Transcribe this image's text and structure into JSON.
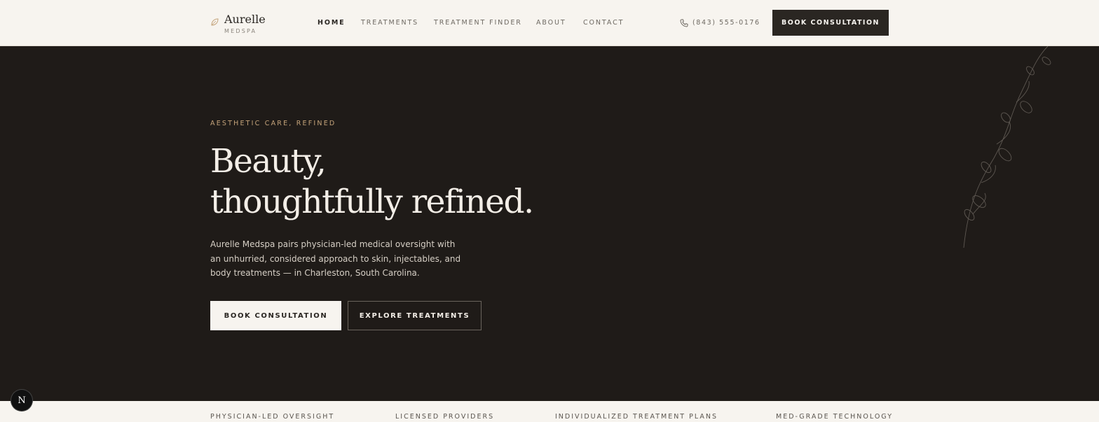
{
  "brand": {
    "name": "Aurelle",
    "sub": "MEDSPA",
    "leaf_color": "#c4a37a"
  },
  "nav": {
    "items": [
      {
        "label": "HOME",
        "active": true
      },
      {
        "label": "TREATMENTS"
      },
      {
        "label": "TREATMENT FINDER"
      },
      {
        "label": "ABOUT"
      },
      {
        "label": "CONTACT"
      }
    ],
    "phone": "(843) 555-0176",
    "cta": "BOOK CONSULTATION"
  },
  "hero": {
    "eyebrow": "AESTHETIC CARE, REFINED",
    "headline": [
      "Beauty,",
      "thoughtfully refined."
    ],
    "body": "Aurelle Medspa pairs physician-led medical oversight with an unhurried, considered approach to skin, injectables, and body treatments — in Charleston, South Carolina.",
    "primary_button": "BOOK CONSULTATION",
    "secondary_button": "EXPLORE TREATMENTS"
  },
  "features": [
    "PHYSICIAN-LED OVERSIGHT",
    "LICENSED PROVIDERS",
    "INDIVIDUALIZED TREATMENT PLANS",
    "MED-GRADE TECHNOLOGY"
  ],
  "badge": {
    "letter": "N"
  },
  "colors": {
    "hero_bg": "#1f1b18",
    "header_bg": "#f7f4ef",
    "accent": "#c4a37a",
    "dark": "#2a2622"
  }
}
